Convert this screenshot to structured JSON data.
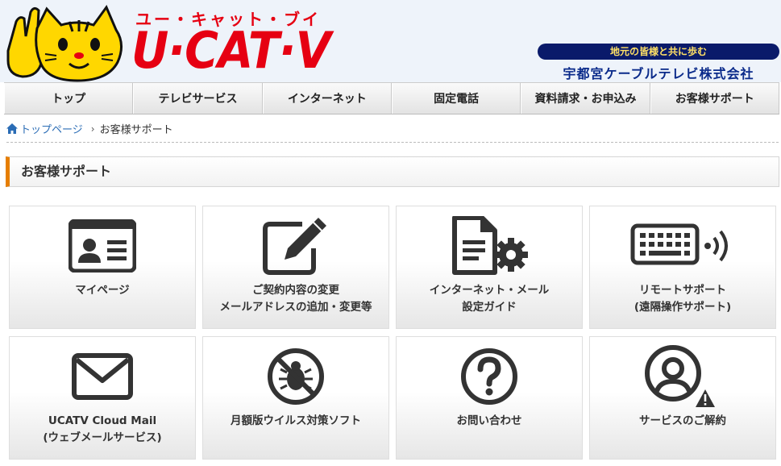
{
  "header": {
    "logo_kana": "ユー・キャット・ブイ",
    "logo_main": "U·CAT·V",
    "tagline": "地元の皆様と共に歩む",
    "company": "宇都宮ケーブルテレビ株式会社",
    "colors": {
      "logo_red": "#e60012",
      "tagline_bg": "#0a1a6a",
      "tagline_text": "#ffe066",
      "company_text": "#0a2a8a"
    }
  },
  "nav": {
    "items": [
      {
        "label": "トップ"
      },
      {
        "label": "テレビサービス"
      },
      {
        "label": "インターネット"
      },
      {
        "label": "固定電話"
      },
      {
        "label": "資料請求・お申込み"
      },
      {
        "label": "お客様サポート"
      }
    ]
  },
  "breadcrumb": {
    "home_icon": "home-icon",
    "home": "トップページ",
    "separator": "›",
    "current": "お客様サポート"
  },
  "section": {
    "title": "お客様サポート",
    "accent": "#e67e00"
  },
  "cards": [
    {
      "icon": "id-card-icon",
      "line1": "マイページ",
      "line2": ""
    },
    {
      "icon": "edit-pencil-icon",
      "line1": "ご契約内容の変更",
      "line2": "メールアドレスの追加・変更等"
    },
    {
      "icon": "document-gear-icon",
      "line1": "インターネット・メール",
      "line2": "設定ガイド"
    },
    {
      "icon": "keyboard-signal-icon",
      "line1": "リモートサポート",
      "line2": "(遠隔操作サポート)"
    },
    {
      "icon": "envelope-icon",
      "line1": "UCATV Cloud Mail",
      "line2": "(ウェブメールサービス)"
    },
    {
      "icon": "no-bug-icon",
      "line1": "月額版ウイルス対策ソフト",
      "line2": ""
    },
    {
      "icon": "question-circle-icon",
      "line1": "お問い合わせ",
      "line2": ""
    },
    {
      "icon": "user-warning-icon",
      "line1": "サービスのご解約",
      "line2": ""
    }
  ]
}
